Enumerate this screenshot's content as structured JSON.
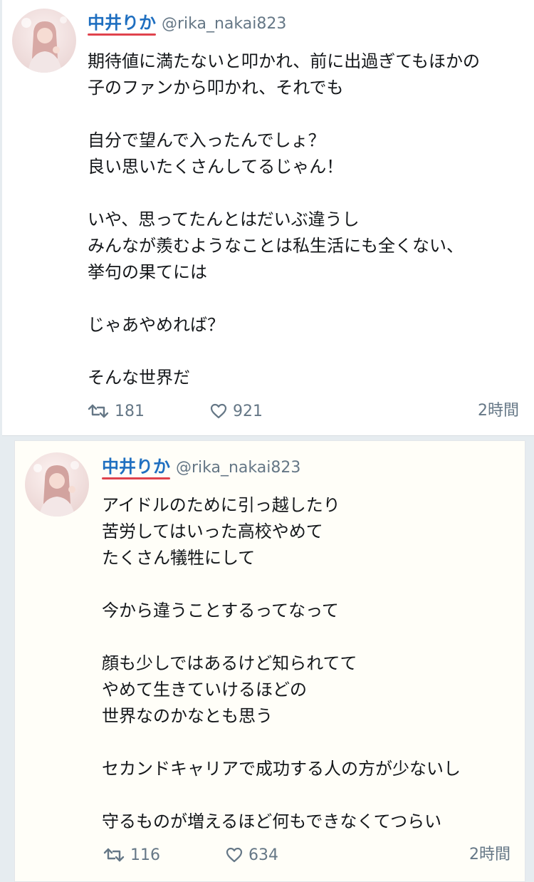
{
  "tweets": [
    {
      "user": {
        "name": "中井りか",
        "handle": "@rika_nakai823"
      },
      "lines": [
        "期待値に満たないと叩かれ、前に出過ぎてもほかの",
        "子のファンから叩かれ、それでも",
        "",
        "自分で望んで入ったんでしょ？",
        "良い思いたくさんしてるじゃん！",
        "",
        "いや、思ってたんとはだいぶ違うし",
        "みんなが羨むようなことは私生活にも全くない、",
        "挙句の果てには",
        "",
        "じゃあやめれば？",
        "",
        "そんな世界だ"
      ],
      "retweets": "181",
      "likes": "921",
      "time": "2時間"
    },
    {
      "user": {
        "name": "中井りか",
        "handle": "@rika_nakai823"
      },
      "lines": [
        "アイドルのために引っ越したり",
        "苦労してはいった高校やめて",
        "たくさん犠牲にして",
        "",
        "今から違うことするってなって",
        "",
        "顔も少しではあるけど知られてて",
        "やめて生きていけるほどの",
        "世界なのかなとも思う",
        "",
        "セカンドキャリアで成功する人の方が少ないし",
        "",
        "守るものが増えるほど何もできなくてつらい"
      ],
      "retweets": "116",
      "likes": "634",
      "time": "2時間"
    }
  ],
  "icons": {
    "retweet": "retweet-icon",
    "like": "heart-icon",
    "avatar": "profile-photo"
  },
  "colors": {
    "name": "#1f6fc0",
    "name_underline": "#e0434d",
    "meta": "#657786",
    "text": "#14171a"
  }
}
